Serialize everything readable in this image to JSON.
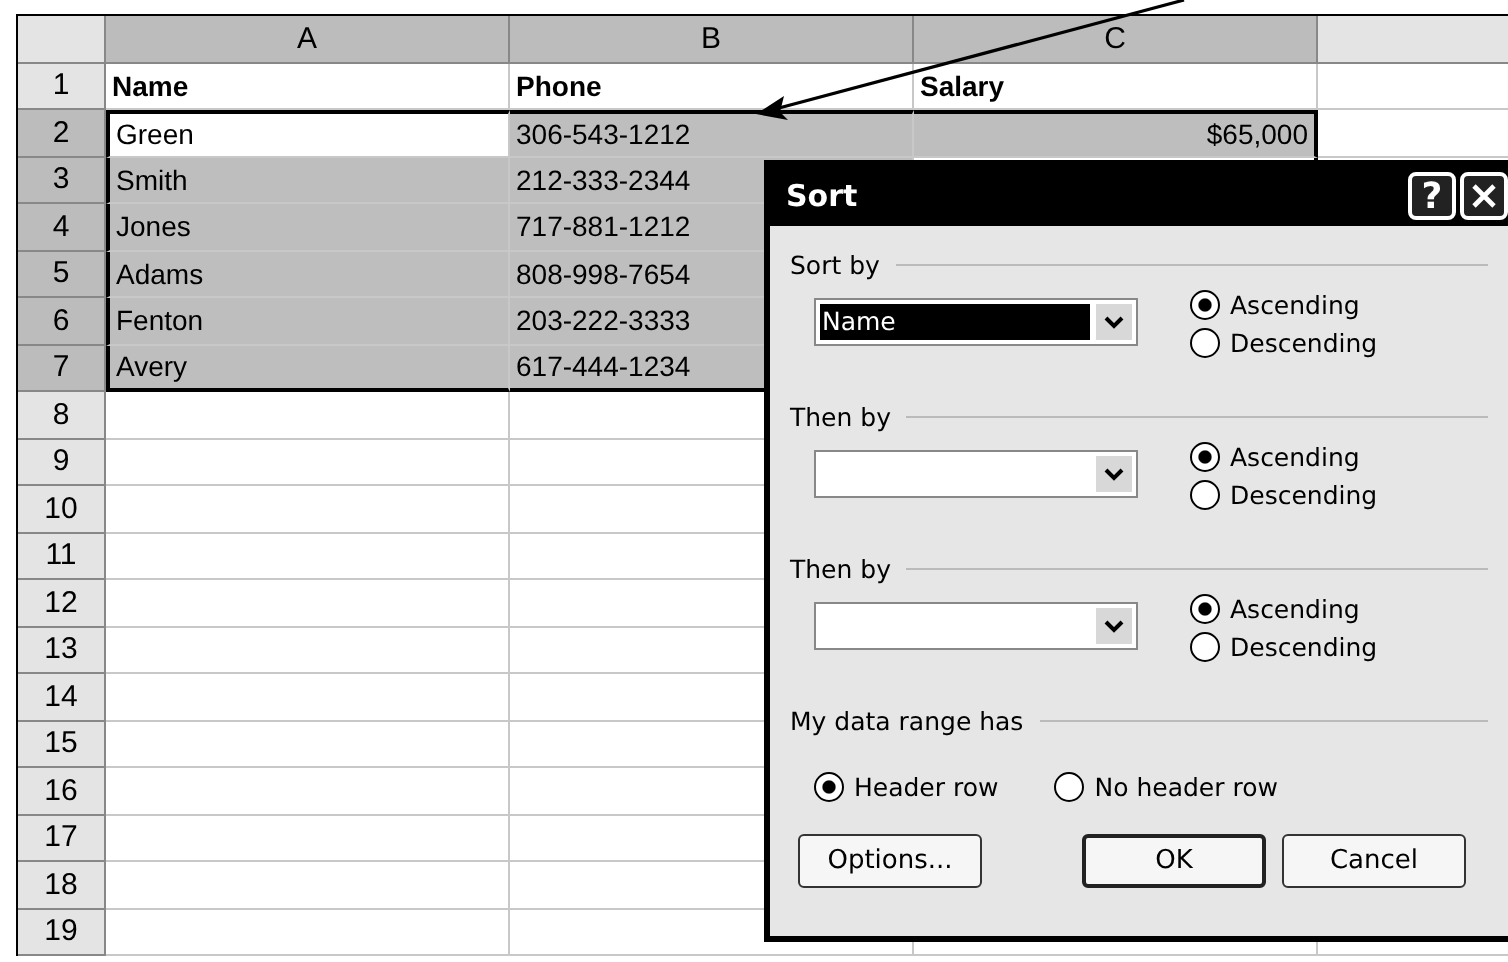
{
  "sheet": {
    "columns": [
      "A",
      "B",
      "C"
    ],
    "rows": [
      {
        "number": "1",
        "kind": "header",
        "cells": [
          {
            "text": "Name",
            "selected": false
          },
          {
            "text": "Phone",
            "selected": false
          },
          {
            "text": "Salary",
            "selected": false
          }
        ]
      },
      {
        "number": "2",
        "cells": [
          {
            "text": "Green",
            "selected": false
          },
          {
            "text": "306-543-1212",
            "selected": true
          },
          {
            "text": "$65,000",
            "selected": true
          }
        ]
      },
      {
        "number": "3",
        "cells": [
          {
            "text": "Smith",
            "selected": true
          },
          {
            "text": "212-333-2344",
            "selected": true
          }
        ]
      },
      {
        "number": "4",
        "cells": [
          {
            "text": "Jones",
            "selected": true
          },
          {
            "text": "717-881-1212",
            "selected": true
          }
        ]
      },
      {
        "number": "5",
        "cells": [
          {
            "text": "Adams",
            "selected": true
          },
          {
            "text": "808-998-7654",
            "selected": true
          }
        ]
      },
      {
        "number": "6",
        "cells": [
          {
            "text": "Fenton",
            "selected": true
          },
          {
            "text": "203-222-3333",
            "selected": true
          }
        ]
      },
      {
        "number": "7",
        "cells": [
          {
            "text": "Avery",
            "selected": true
          },
          {
            "text": "617-444-1234",
            "selected": true
          }
        ]
      },
      {
        "number": "8"
      },
      {
        "number": "9"
      },
      {
        "number": "10"
      },
      {
        "number": "11"
      },
      {
        "number": "12"
      },
      {
        "number": "13"
      },
      {
        "number": "14"
      },
      {
        "number": "15"
      },
      {
        "number": "16"
      },
      {
        "number": "17"
      },
      {
        "number": "18"
      },
      {
        "number": "19"
      }
    ]
  },
  "dialog": {
    "title": "Sort",
    "help_button": "?",
    "sort_levels": [
      {
        "label": "Sort by",
        "value": "Name",
        "options": [
          {
            "label": "Ascending",
            "selected": true
          },
          {
            "label": "Descending",
            "selected": false
          }
        ]
      },
      {
        "label": "Then by",
        "options": [
          {
            "label": "Ascending",
            "selected": true
          },
          {
            "label": "Descending",
            "selected": false
          }
        ]
      },
      {
        "label": "Then by",
        "options": [
          {
            "label": "Ascending",
            "selected": true
          },
          {
            "label": "Descending",
            "selected": false
          }
        ]
      }
    ],
    "range_label": "My data range has",
    "range_options": [
      {
        "label": "Header row",
        "selected": true
      },
      {
        "label": "No header row",
        "selected": false
      }
    ],
    "buttons": [
      {
        "label": "Options...",
        "kind": "secondary"
      },
      {
        "label": "OK",
        "kind": "default"
      },
      {
        "label": "Cancel",
        "kind": "normal"
      }
    ]
  }
}
